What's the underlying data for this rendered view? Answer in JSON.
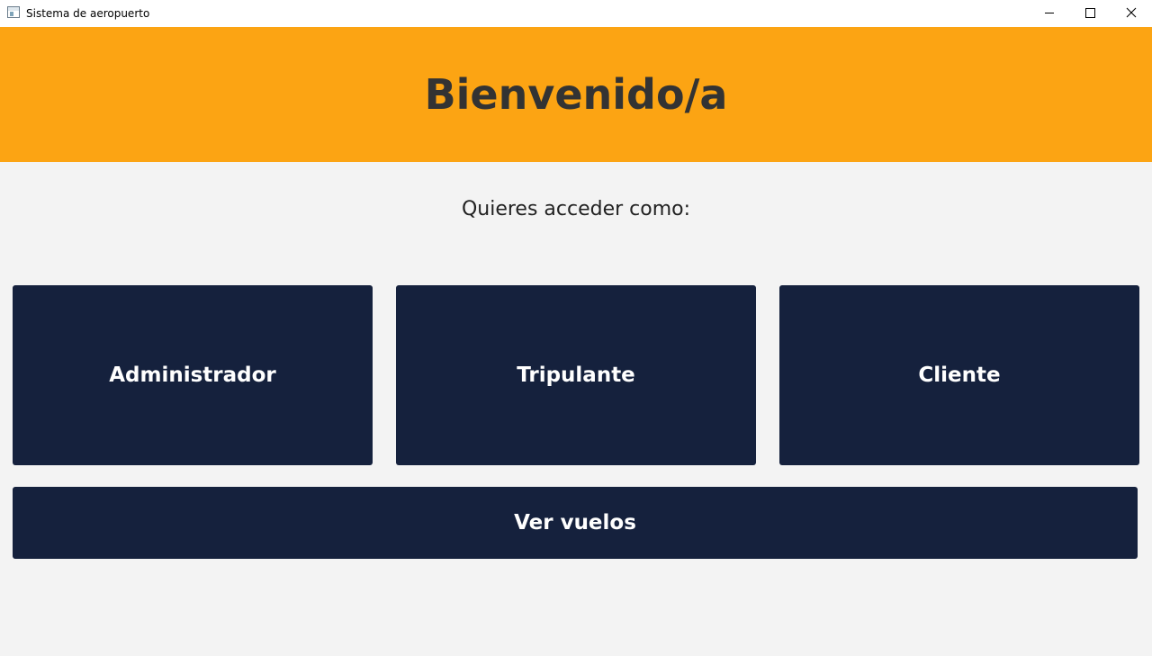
{
  "window": {
    "title": "Sistema de aeropuerto",
    "controls": {
      "minimize": "minimize-icon",
      "maximize": "maximize-icon",
      "close": "close-icon"
    }
  },
  "header": {
    "title": "Bienvenido/a",
    "background": "#fca413"
  },
  "main": {
    "prompt": "Quieres acceder como:",
    "buttons": {
      "admin": "Administrador",
      "crew": "Tripulante",
      "client": "Cliente",
      "flights": "Ver vuelos"
    },
    "button_color": "#15213d"
  }
}
